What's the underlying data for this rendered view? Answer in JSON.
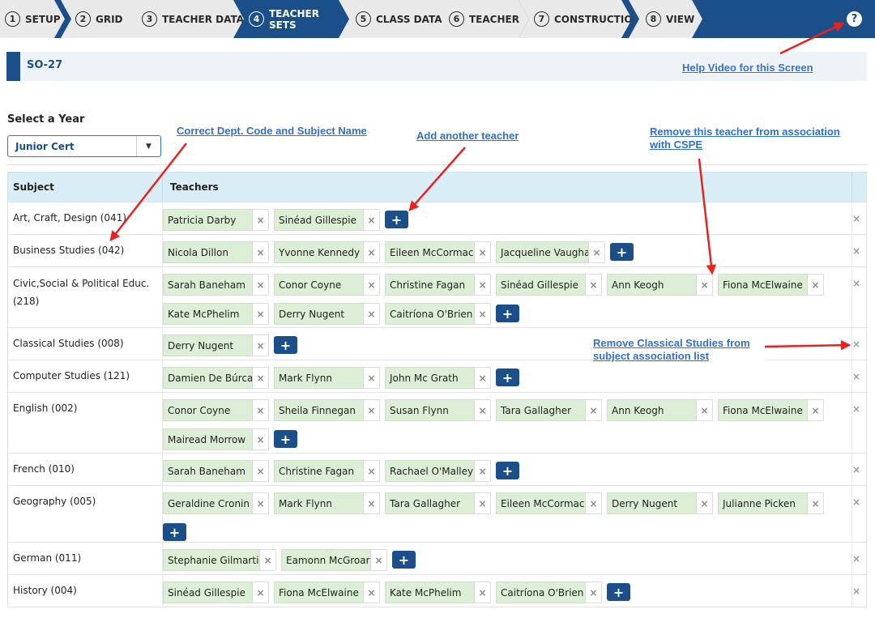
{
  "wizard": {
    "steps": [
      {
        "num": "1",
        "label": "SETUP"
      },
      {
        "num": "2",
        "label": "GRID"
      },
      {
        "num": "3",
        "label": "TEACHER DATA"
      },
      {
        "num": "4",
        "label": "TEACHER SETS"
      },
      {
        "num": "5",
        "label": "CLASS DATA"
      },
      {
        "num": "6",
        "label": "TEACHER"
      },
      {
        "num": "7",
        "label": "CONSTRUCTION"
      },
      {
        "num": "8",
        "label": "VIEW"
      }
    ],
    "help_glyph": "?"
  },
  "page": {
    "title": "SO-27"
  },
  "year": {
    "label": "Select a Year",
    "selected": "Junior Cert"
  },
  "table": {
    "col_subject": "Subject",
    "col_teachers": "Teachers"
  },
  "glyphs": {
    "remove": "×",
    "add": "+"
  },
  "subjects": [
    {
      "name": "Art, Craft, Design (041)",
      "teachers": [
        "Patricia Darby",
        "Sinéad Gillespie"
      ]
    },
    {
      "name": "Business Studies (042)",
      "teachers": [
        "Nicola Dillon",
        "Yvonne Kennedy",
        "Eileen McCormack",
        "Jacqueline Vaughan"
      ]
    },
    {
      "name": "Civic,Social & Political Educ. (218)",
      "teachers": [
        "Sarah Baneham",
        "Conor Coyne",
        "Christine Fagan",
        "Sinéad Gillespie",
        "Ann Keogh",
        "Fiona McElwaine",
        "Kate McPhelim",
        "Derry Nugent",
        "Caitríona O'Brien"
      ]
    },
    {
      "name": "Classical Studies (008)",
      "teachers": [
        "Derry Nugent"
      ]
    },
    {
      "name": "Computer Studies (121)",
      "teachers": [
        "Damien De Búrca",
        "Mark Flynn",
        "John Mc Grath"
      ]
    },
    {
      "name": "English (002)",
      "teachers": [
        "Conor Coyne",
        "Sheila Finnegan",
        "Susan Flynn",
        "Tara Gallagher",
        "Ann Keogh",
        "Fiona McElwaine",
        "Mairead Morrow"
      ]
    },
    {
      "name": "French (010)",
      "teachers": [
        "Sarah Baneham",
        "Christine Fagan",
        "Rachael O'Malley"
      ]
    },
    {
      "name": "Geography (005)",
      "teachers": [
        "Geraldine Cronin",
        "Mark Flynn",
        "Tara Gallagher",
        "Eileen McCormack",
        "Derry Nugent",
        "Julianne Picken"
      ]
    },
    {
      "name": "German (011)",
      "teachers": [
        "Stephanie Gilmartin",
        "Eamonn McGroary"
      ]
    },
    {
      "name": "History (004)",
      "teachers": [
        "Sinéad Gillespie",
        "Fiona McElwaine",
        "Kate McPhelim",
        "Caitríona O'Brien"
      ]
    }
  ],
  "annotations": {
    "help_video": "Help Video for this Screen",
    "dept_code": "Correct Dept. Code and Subject Name",
    "add_teacher": "Add another teacher",
    "remove_teacher": "Remove this teacher from association with CSPE",
    "remove_classical": "Remove Classical Studies from subject association list"
  },
  "colors": {
    "brand": "#1b4f8a",
    "chip": "#dcefd6",
    "header": "#d9edf7",
    "annotation": "#2f6fd6",
    "arrow": "#e8231f"
  }
}
